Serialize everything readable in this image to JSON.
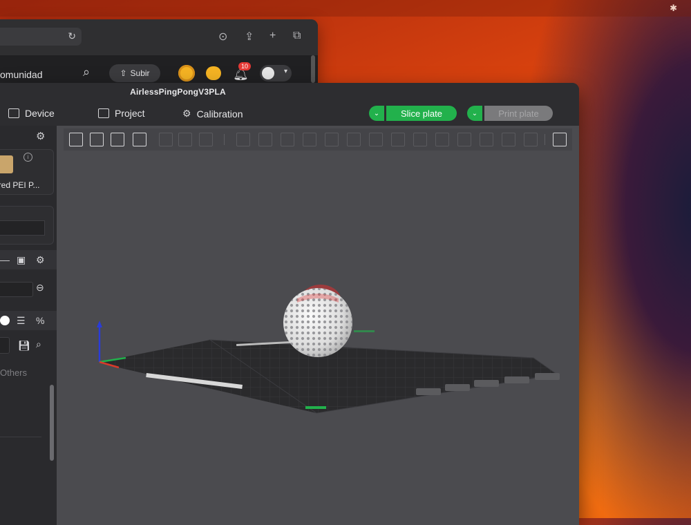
{
  "browser": {
    "community_label": "omunidad",
    "upload_label": "Subir",
    "notification_count": "10",
    "icons": [
      "reload-icon",
      "download-icon",
      "share-icon",
      "new-tab-icon",
      "tabs-icon",
      "search-icon",
      "upload-icon",
      "coin-icon",
      "chat-icon",
      "bell-icon",
      "avatar"
    ]
  },
  "slicer": {
    "title": "AirlessPingPongV3PLA",
    "nav": {
      "device": "Device",
      "project": "Project",
      "calibration": "Calibration"
    },
    "slice_button": "Slice plate",
    "print_button": "Print plate",
    "left_panel": {
      "plate_label": "ured PEI P...",
      "others_label": "Others"
    }
  },
  "colors": {
    "accent_green": "#22b14c",
    "disabled_gray": "#7a7a7c",
    "viewport_bg": "#4b4b4f",
    "model_white": "#e6e6e6",
    "highlight_red": "#e03030"
  }
}
